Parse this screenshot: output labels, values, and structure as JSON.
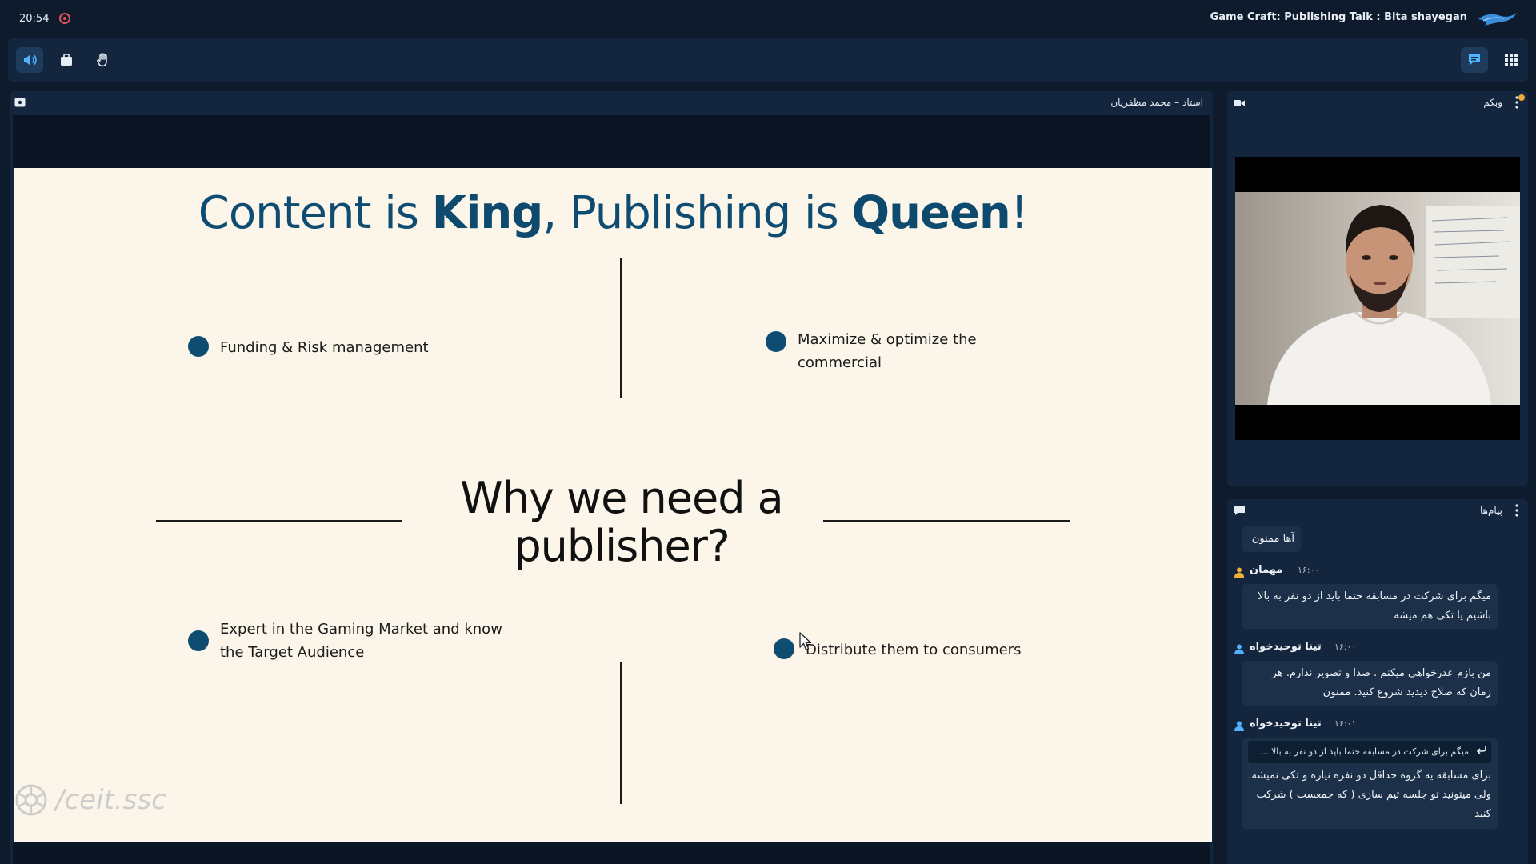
{
  "topbar": {
    "clock": "20:54",
    "session_title": "Game Craft: Publishing Talk : Bita shayegan"
  },
  "toolbar": {
    "left_icons": [
      "speaker-icon",
      "share-icon",
      "raise-hand-icon"
    ],
    "right_icons": [
      "chat-icon",
      "apps-grid-icon"
    ]
  },
  "presentation": {
    "presenter_label": "استاد – محمد مظفریان",
    "slide": {
      "title_pre": "Content is ",
      "title_bold1": "King",
      "title_mid": ", Publishing is ",
      "title_bold2": "Queen",
      "title_post": "!",
      "center_line1": "Why we need a",
      "center_line2": "publisher?",
      "bullets": [
        "Funding & Risk management",
        "Maximize & optimize the commercial",
        "Expert in the Gaming Market and know the Target Audience",
        "Distribute them to consumers"
      ],
      "watermark": "/ceit.ssc",
      "accent_color": "#0e4c71"
    }
  },
  "webcam": {
    "title": "وبکم"
  },
  "chat": {
    "title": "پیام‌ها",
    "first_bubble": "آها ممنون",
    "messages": [
      {
        "sender": "مهمان",
        "time": "۱۶:۰۰",
        "text": "میگم برای شرکت در مسابقه حتما باید از دو نفر به بالا باشیم یا تکی هم میشه"
      },
      {
        "sender": "تینا توحیدخواه",
        "time": "۱۶:۰۰",
        "text": "من بازم عذرخواهی میکنم . صدا و تصویر ندارم. هر زمان که صلاح دیدید شروع کنید. ممنون"
      },
      {
        "sender": "تینا توحیدخواه",
        "time": "۱۶:۰۱",
        "reply_quote": "میگم برای شرکت در مسابقه حتما باید از دو نفر به بالا ...",
        "text": "برای مسابقه یه گروه حداقل دو نفره نیازه و تکی نمیشه. ولی میتونید تو جلسه تیم سازی ( که جمعست ) شرکت کنید"
      }
    ]
  }
}
